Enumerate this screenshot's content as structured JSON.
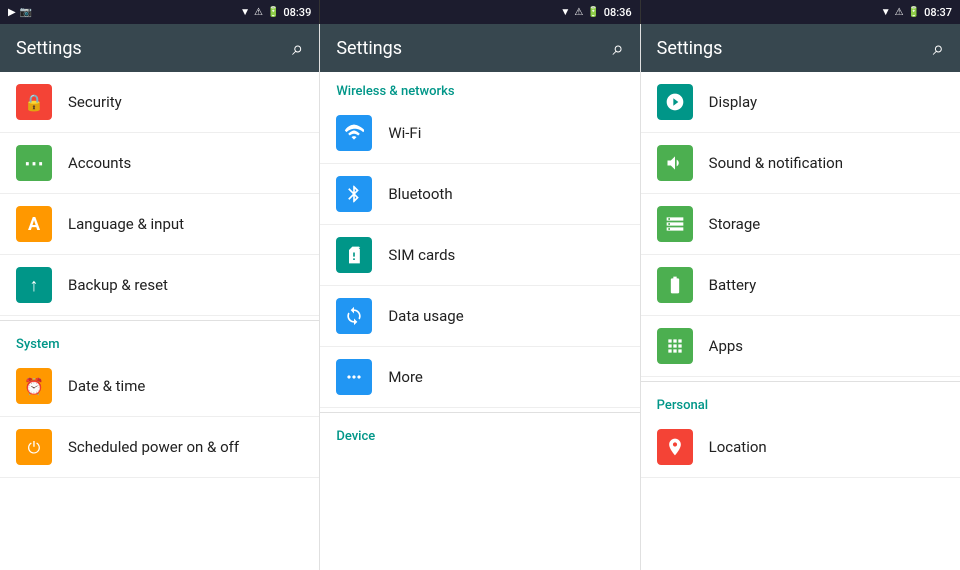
{
  "statusBars": [
    {
      "leftIcons": [
        "▶",
        "📷"
      ],
      "time": "08:39",
      "rightIcons": [
        "▼",
        "⚠",
        "🔋"
      ]
    },
    {
      "leftIcons": [],
      "time": "08:36",
      "rightIcons": [
        "▼",
        "⚠",
        "🔋"
      ]
    },
    {
      "leftIcons": [],
      "time": "08:37",
      "rightIcons": [
        "▼",
        "⚠",
        "🔋"
      ]
    }
  ],
  "panels": [
    {
      "title": "Settings",
      "searchLabel": "Search",
      "sections": [
        {
          "header": null,
          "items": [
            {
              "icon": "security",
              "iconColor": "icon-red",
              "label": "Security"
            },
            {
              "icon": "accounts",
              "iconColor": "icon-green",
              "label": "Accounts"
            },
            {
              "icon": "language",
              "iconColor": "icon-orange",
              "label": "Language & input"
            },
            {
              "icon": "backup",
              "iconColor": "icon-teal",
              "label": "Backup & reset"
            }
          ]
        },
        {
          "header": "System",
          "items": [
            {
              "icon": "datetime",
              "iconColor": "icon-orange",
              "label": "Date & time"
            },
            {
              "icon": "power",
              "iconColor": "icon-orange",
              "label": "Scheduled power on & off"
            }
          ]
        }
      ]
    },
    {
      "title": "Settings",
      "searchLabel": "Search",
      "sections": [
        {
          "header": "Wireless & networks",
          "items": [
            {
              "icon": "wifi",
              "iconColor": "icon-blue",
              "label": "Wi-Fi"
            },
            {
              "icon": "bluetooth",
              "iconColor": "icon-blue",
              "label": "Bluetooth"
            },
            {
              "icon": "sim",
              "iconColor": "icon-teal",
              "label": "SIM cards"
            },
            {
              "icon": "data",
              "iconColor": "icon-blue",
              "label": "Data usage"
            },
            {
              "icon": "more",
              "iconColor": "icon-blue",
              "label": "More"
            }
          ]
        },
        {
          "header": "Device",
          "items": []
        }
      ]
    },
    {
      "title": "Settings",
      "searchLabel": "Search",
      "sections": [
        {
          "header": null,
          "items": [
            {
              "icon": "display",
              "iconColor": "icon-teal",
              "label": "Display"
            },
            {
              "icon": "sound",
              "iconColor": "icon-green",
              "label": "Sound & notification"
            },
            {
              "icon": "storage",
              "iconColor": "icon-green",
              "label": "Storage"
            },
            {
              "icon": "battery",
              "iconColor": "icon-green",
              "label": "Battery"
            },
            {
              "icon": "apps",
              "iconColor": "icon-green",
              "label": "Apps"
            }
          ]
        },
        {
          "header": "Personal",
          "items": [
            {
              "icon": "location",
              "iconColor": "icon-red",
              "label": "Location"
            }
          ]
        }
      ]
    }
  ]
}
